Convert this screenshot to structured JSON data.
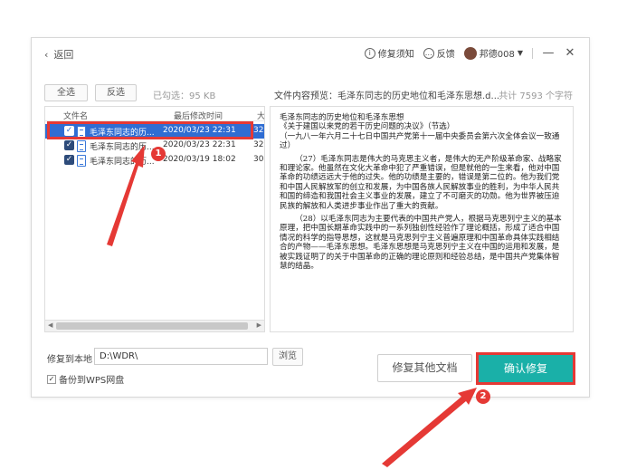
{
  "titlebar": {
    "back_label": "返回",
    "guide_label": "修复须知",
    "feedback_label": "反馈",
    "user_label": "邦德008"
  },
  "toolbar": {
    "select_all": "全选",
    "invert": "反选",
    "selected_size": "已勾选：95 KB"
  },
  "preview_header": {
    "title": "文件内容预览：毛泽东同志的历史地位和毛泽东思想.d...",
    "char_count": "共计 7593 个字符"
  },
  "file_list": {
    "columns": [
      "文件名",
      "最后修改时间",
      "大"
    ],
    "rows": [
      {
        "name": "毛泽东同志的历...",
        "modified": "2020/03/23 22:31",
        "size": "32",
        "selected": true
      },
      {
        "name": "毛泽东同志的历...",
        "modified": "2020/03/23 22:31",
        "size": "32",
        "selected": false
      },
      {
        "name": "毛泽东同志的历...",
        "modified": "2020/03/19 18:02",
        "size": "30",
        "selected": false
      }
    ]
  },
  "preview_text": [
    "毛泽东同志的历史地位和毛泽东思想",
    "《关于建国以来党的若干历史问题的决议》（节选）",
    "（一九八一年六月二十七日中国共产党第十一届中央委员会第六次全体会议一致通过）",
    "（27）毛泽东同志是伟大的马克思主义者，是伟大的无产阶级革命家、战略家和理论家。他虽然在文化大革命中犯了严重错误，但是就他的一生来看，他对中国革命的功绩远远大于他的过失。他的功绩是主要的，错误是第二位的。他为我们党和中国人民解放军的创立和发展，为中国各族人民解放事业的胜利，为中华人民共和国的缔造和我国社会主义事业的发展，建立了不可磨灭的功勋。他为世界被压迫民族的解放和人类进步事业作出了重大的贡献。",
    "（28）以毛泽东同志为主要代表的中国共产党人，根据马克思列宁主义的基本原理，把中国长期革命实践中的一系列独创性经验作了理论概括，形成了适合中国情况的科学的指导思想，这就是马克思列宁主义普遍原理和中国革命具体实践相结合的产物——毛泽东思想。毛泽东思想是马克思列宁主义在中国的运用和发展，是被实践证明了的关于中国革命的正确的理论原则和经验总结，是中国共产党集体智慧的结晶。"
  ],
  "restore": {
    "label": "修复到本地",
    "path": "D:\\WDR\\",
    "browse": "浏览",
    "backup_label": "备份到WPS网盘",
    "repair_other": "修复其他文档",
    "confirm": "确认修复"
  },
  "annotations": {
    "badge1": "1",
    "badge2": "2"
  },
  "colors": {
    "accent": "#1ab0a8",
    "highlight": "#e53935",
    "row_selected": "#2f6dd3"
  }
}
